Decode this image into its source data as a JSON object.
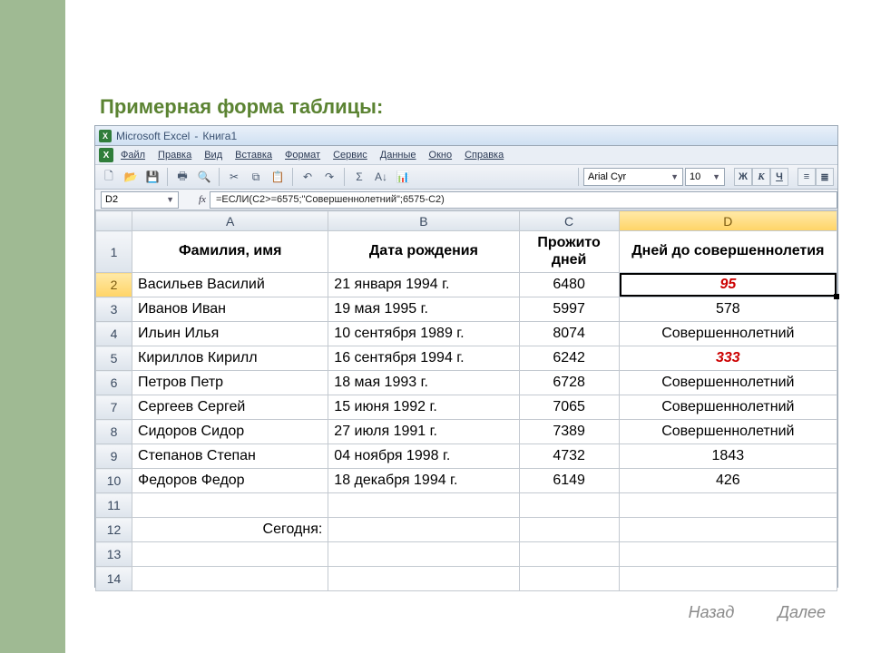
{
  "slide": {
    "title": "Примерная форма таблицы:"
  },
  "titlebar": {
    "app": "Microsoft Excel",
    "doc": "Книга1"
  },
  "menu": {
    "file": "Файл",
    "edit": "Правка",
    "view": "Вид",
    "insert": "Вставка",
    "format": "Формат",
    "tools": "Сервис",
    "data": "Данные",
    "window": "Окно",
    "help": "Справка"
  },
  "fontbar": {
    "name": "Arial Cyr",
    "size": "10"
  },
  "namebox": "D2",
  "formula": "=ЕСЛИ(C2>=6575;\"Совершеннолетний\";6575-C2)",
  "columns": [
    "A",
    "B",
    "C",
    "D"
  ],
  "headers": {
    "A": "Фамилия, имя",
    "B": "Дата рождения",
    "C": "Прожито дней",
    "D": "Дней до совершеннолетия"
  },
  "rows": [
    {
      "n": 2,
      "A": "Васильев Василий",
      "B": "21 января 1994 г.",
      "C": "6480",
      "D": "95",
      "Dred": true,
      "active": true
    },
    {
      "n": 3,
      "A": "Иванов Иван",
      "B": "19 мая 1995 г.",
      "C": "5997",
      "D": "578"
    },
    {
      "n": 4,
      "A": "Ильин Илья",
      "B": "10 сентября 1989 г.",
      "C": "8074",
      "D": "Совершеннолетний"
    },
    {
      "n": 5,
      "A": "Кириллов Кирилл",
      "B": "16 сентября 1994 г.",
      "C": "6242",
      "D": "333",
      "Dred": true
    },
    {
      "n": 6,
      "A": "Петров Петр",
      "B": "18 мая 1993 г.",
      "C": "6728",
      "D": "Совершеннолетний"
    },
    {
      "n": 7,
      "A": "Сергеев Сергей",
      "B": "15 июня 1992 г.",
      "C": "7065",
      "D": "Совершеннолетний"
    },
    {
      "n": 8,
      "A": "Сидоров Сидор",
      "B": "27 июля 1991 г.",
      "C": "7389",
      "D": "Совершеннолетний"
    },
    {
      "n": 9,
      "A": "Степанов Степан",
      "B": "04 ноября 1998 г.",
      "C": "4732",
      "D": "1843"
    },
    {
      "n": 10,
      "A": "Федоров Федор",
      "B": "18 декабря 1994 г.",
      "C": "6149",
      "D": "426"
    },
    {
      "n": 11
    },
    {
      "n": 12,
      "A": "Сегодня:",
      "Aright": true
    },
    {
      "n": 13
    },
    {
      "n": 14
    }
  ],
  "nav": {
    "prev": "Назад",
    "next": "Далее"
  }
}
